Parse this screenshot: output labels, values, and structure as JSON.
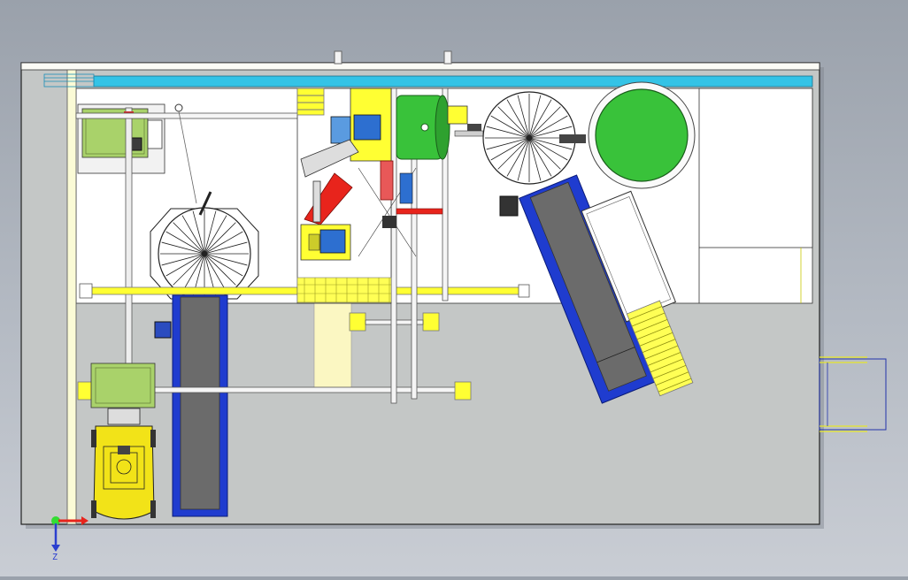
{
  "viewport": {
    "title": "",
    "view_orientation": "top view (plan)",
    "background": "gradient-grey"
  },
  "triad": {
    "x_label": "",
    "z_label": "Z"
  },
  "colors": {
    "floor": "#c3c6c6",
    "building_edge": "#2a2a2a",
    "conveyor_belt": "#1f3ccf",
    "belt_surface": "#6b6b6b",
    "handrail": "#ffff33",
    "water_channel": "#34c3e6",
    "tank_green": "#39c23a",
    "pipe_red": "#e8241c",
    "panel_green": "#a9d26a",
    "motor_blue": "#2d6fd0",
    "stair_yellow": "#f4f04a",
    "forklift_yellow": "#f2e318",
    "outline_blue": "#2233aa"
  },
  "icons": {
    "triad_x_arrow": "arrow-right-icon",
    "triad_z_arrow": "arrow-down-icon",
    "triad_origin": "origin-dot-icon"
  }
}
